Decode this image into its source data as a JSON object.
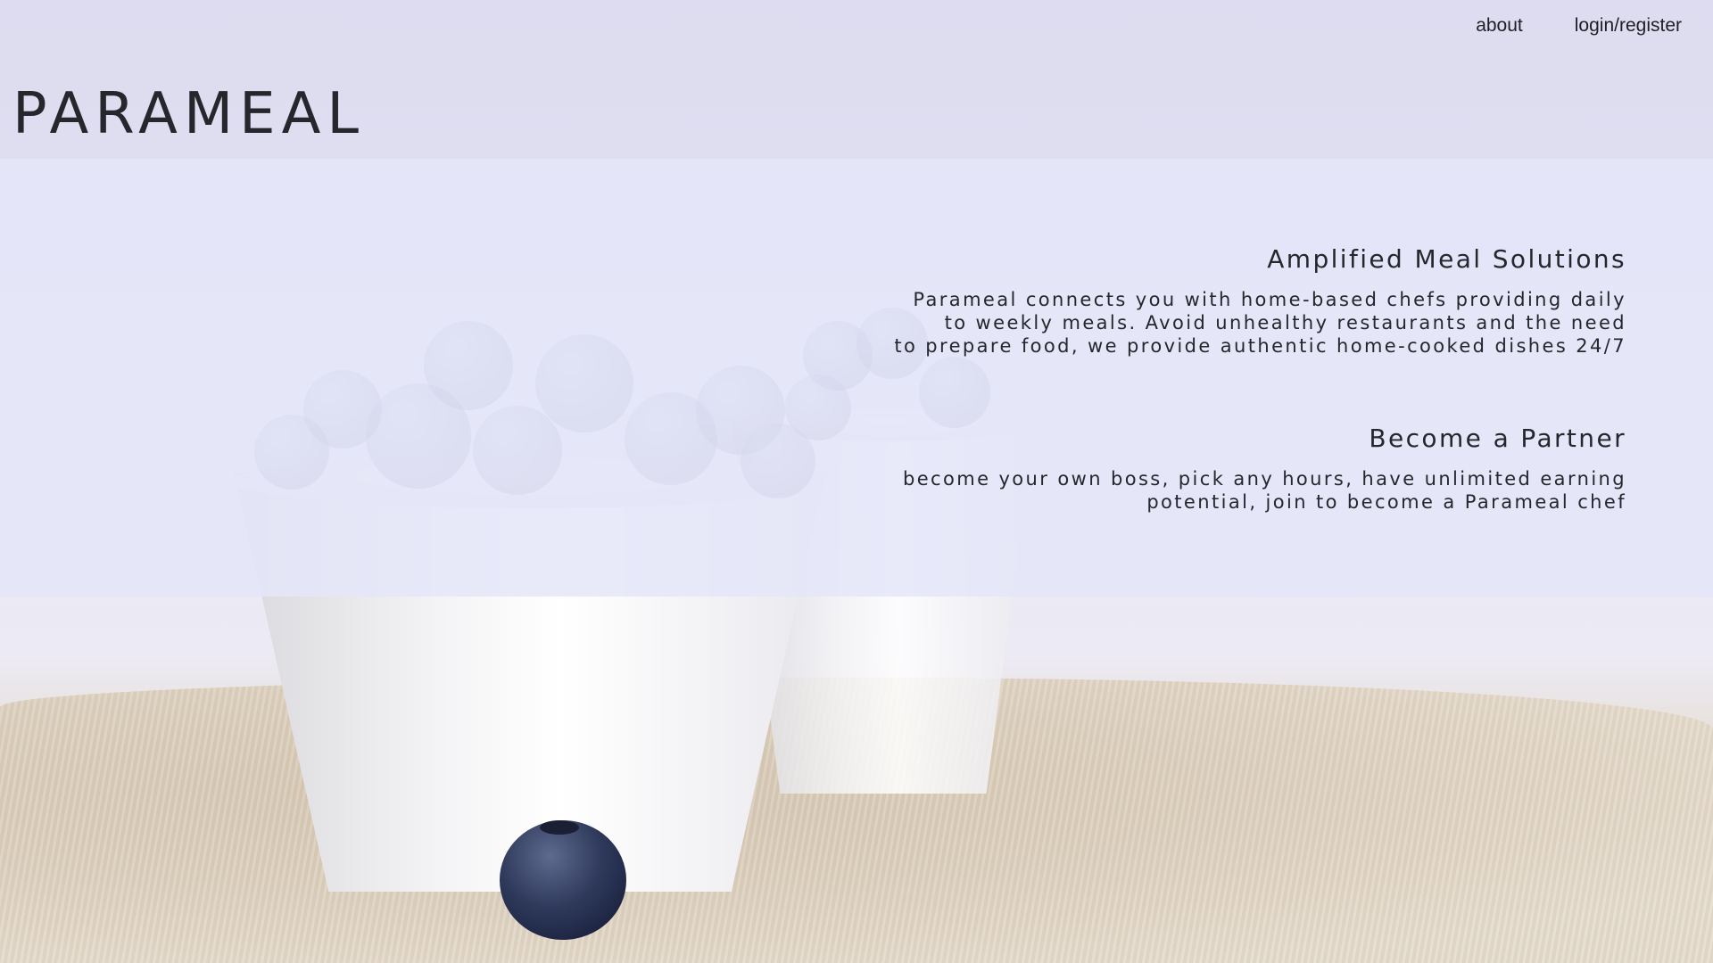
{
  "nav": {
    "about_label": "about",
    "login_label": "login/register"
  },
  "brand": {
    "logo_text": "PARAMEAL"
  },
  "sections": [
    {
      "heading": "Amplified Meal Solutions",
      "body": "Parameal connects you with home-based chefs providing daily\nto weekly meals. Avoid unhealthy restaurants and the need\nto prepare food, we provide authentic home-cooked dishes 24/7"
    },
    {
      "heading": "Become a Partner",
      "body": "become your own boss, pick any hours, have unlimited earning\npotential, join to become a Parameal chef"
    }
  ],
  "colors": {
    "text": "#26262d",
    "overlay": "#e4e5f8",
    "accent_blueberry": "#2f3a5c"
  }
}
